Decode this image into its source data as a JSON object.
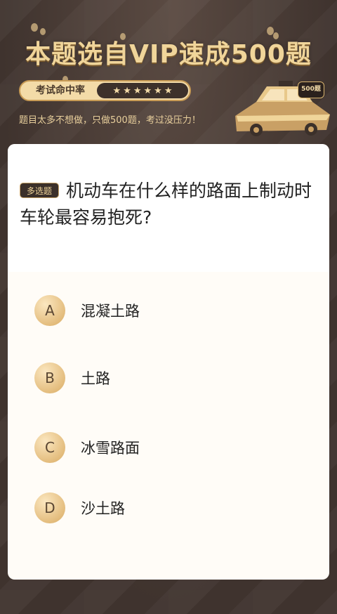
{
  "banner": {
    "title": "本题选自VIP速成500题",
    "rate_label": "考试命中率",
    "stars": [
      "★",
      "★",
      "★",
      "★",
      "★",
      "★"
    ],
    "subtitle": "题目太多不想做，只做500题，考过没压力！",
    "badge": "500题"
  },
  "question": {
    "type_label": "多选题",
    "text": "机动车在什么样的路面上制动时车轮最容易抱死?"
  },
  "options": [
    {
      "letter": "A",
      "text": "混凝土路"
    },
    {
      "letter": "B",
      "text": "土路"
    },
    {
      "letter": "C",
      "text": "冰雪路面"
    },
    {
      "letter": "D",
      "text": "沙土路"
    }
  ],
  "colors": {
    "gold": "#f0d59a",
    "dark": "#3b302a",
    "card": "#fffcf7"
  }
}
